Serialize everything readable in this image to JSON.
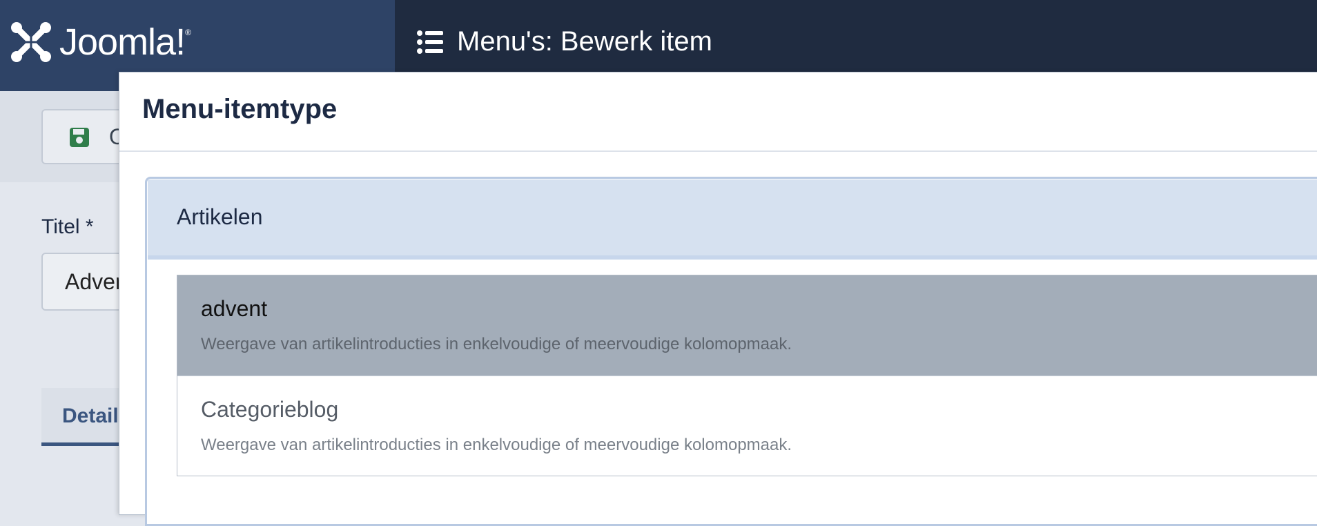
{
  "header": {
    "logo_text": "Joomla!",
    "page_title": "Menu's: Bewerk item"
  },
  "toolbar": {
    "save_label": "O"
  },
  "form": {
    "title_label": "Titel *",
    "title_value": "Adver",
    "tab_label": "Detail"
  },
  "modal": {
    "title": "Menu-itemtype",
    "group_label": "Artikelen",
    "items": [
      {
        "title": "advent",
        "description": "Weergave van artikelintroducties in enkelvoudige of meervoudige kolomopmaak."
      },
      {
        "title": "Categorieblog",
        "description": "Weergave van artikelintroducties in enkelvoudige of meervoudige kolomopmaak."
      }
    ]
  },
  "colors": {
    "sidebar_header": "#2e4366",
    "topbar": "#1f2b40",
    "accordion_head": "#d6e1f0",
    "active_item": "#a3adb9",
    "save_icon": "#2f7d4a"
  },
  "icons": [
    "joomla-logo-icon",
    "list-icon",
    "save-icon"
  ]
}
